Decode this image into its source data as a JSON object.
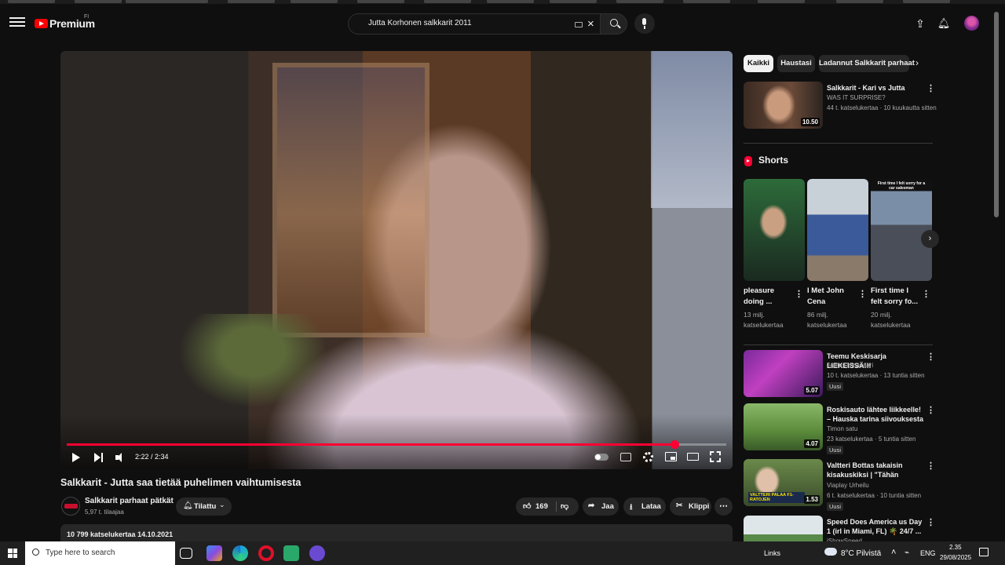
{
  "header": {
    "logo_text": "Premium",
    "region": "FI",
    "search_query": "Jutta Korhonen salkkarit 2011"
  },
  "player": {
    "time_label": "2:22 / 2:34",
    "progress_fraction": 0.922
  },
  "video": {
    "title": "Salkkarit - Jutta saa tietää puhelimen vaihtumisesta",
    "channel_name": "Salkkarit parhaat pätkät",
    "channel_subs": "5,97 t. tilaajaa",
    "subscribe_label": "Tilattu",
    "like_count": "169",
    "share_label": "Jaa",
    "download_label": "Lataa",
    "clip_label": "Klippi",
    "description_meta": "10 799 katselukertaa  14.10.2021"
  },
  "chips": [
    "Kaikki",
    "Haustasi",
    "Ladannut Salkkarit parhaat"
  ],
  "top_rec": {
    "title": "Salkkarit - Kari vs Jutta",
    "channel": "WAS IT SURPRISE?",
    "meta": "44 t. katselukertaa · 10 kuukautta sitten",
    "duration": "10.50"
  },
  "shorts": {
    "heading": "Shorts",
    "items": [
      {
        "title": "pleasure doing ...",
        "views": "13 milj. katselukertaa",
        "caption": ""
      },
      {
        "title": "I Met John Cena",
        "views": "86 milj. katselukertaa",
        "caption": ""
      },
      {
        "title": "First time I felt sorry fo...",
        "views": "20 milj. katselukertaa",
        "caption": "First time I felt sorry for a car salesman"
      }
    ]
  },
  "recs": [
    {
      "title": "Teemu Keskisarja LIEKEISSÄ!!!",
      "channel": "James Hirvisaari",
      "meta": "10 t. katselukertaa · 13 tuntia sitten",
      "badge": "Uusi",
      "duration": "5.07"
    },
    {
      "title": "Roskisauto lähtee liikkeelle! – Hauska tarina siivouksesta ja ...",
      "channel": "Timon satu",
      "meta": "23 katselukertaa · 5 tuntia sitten",
      "badge": "Uusi",
      "duration": "4.07"
    },
    {
      "title": "Valtteri Bottas takaisin kisakuskiksi | \"Tähän projekti...",
      "channel": "Viaplay Urheilu",
      "meta": "6 t. katselukertaa · 10 tuntia sitten",
      "badge": "Uusi",
      "duration": "1.53",
      "thumb_caption": "VALTTERI PALAA F1-RATOJEN"
    },
    {
      "title": "Speed Does America us Day 1 (irl in Miami, FL) 🌴 24/7 ...",
      "channel": "iShowSpeed",
      "meta": "",
      "badge": "",
      "duration": ""
    }
  ],
  "taskbar": {
    "search_placeholder": "Type here to search",
    "links_label": "Links",
    "weather": "8°C  Pilvistä",
    "lang": "ENG",
    "time": "2.35",
    "date": "29/08/2025"
  }
}
